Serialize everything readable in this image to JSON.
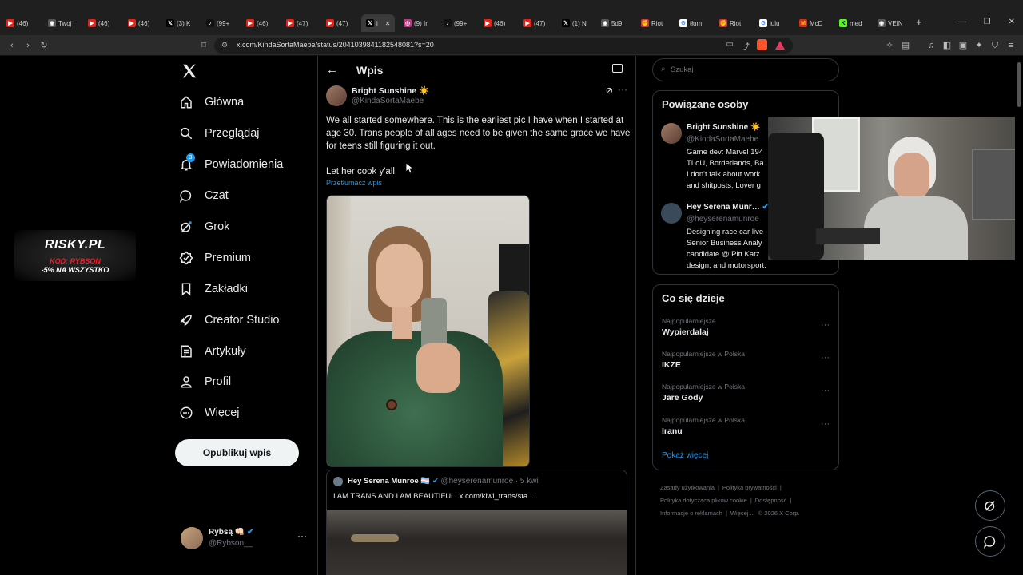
{
  "browser": {
    "tabs": [
      {
        "icon": "yt",
        "label": "(46)"
      },
      {
        "icon": "gen",
        "label": "Twoj"
      },
      {
        "icon": "yt",
        "label": "(46)"
      },
      {
        "icon": "yt",
        "label": "(46)"
      },
      {
        "icon": "x",
        "label": "(3) K"
      },
      {
        "icon": "tk",
        "label": "(99+"
      },
      {
        "icon": "yt",
        "label": "(46)"
      },
      {
        "icon": "yt",
        "label": "(47)"
      },
      {
        "icon": "yt",
        "label": "(47)"
      },
      {
        "icon": "x",
        "label": "i"
      },
      {
        "icon": "ig",
        "label": "(9) Ir"
      },
      {
        "icon": "tk",
        "label": "(99+"
      },
      {
        "icon": "yt",
        "label": "(46)"
      },
      {
        "icon": "yt",
        "label": "(47)"
      },
      {
        "icon": "x",
        "label": "(1) N"
      },
      {
        "icon": "gen",
        "label": "5d9!"
      },
      {
        "icon": "riot",
        "label": "Riot"
      },
      {
        "icon": "gl",
        "label": "tłum"
      },
      {
        "icon": "riot",
        "label": "Riot"
      },
      {
        "icon": "gl",
        "label": "lulu"
      },
      {
        "icon": "mcd",
        "label": "McD"
      },
      {
        "icon": "k",
        "label": "med"
      },
      {
        "icon": "gen",
        "label": "VEIN"
      }
    ],
    "url": "x.com/KindaSortaMaebe/status/2041039841182548081?s=20"
  },
  "nav": {
    "items": [
      {
        "label": "Główna",
        "icon": "home-icon"
      },
      {
        "label": "Przeglądaj",
        "icon": "search-icon"
      },
      {
        "label": "Powiadomienia",
        "icon": "bell-icon",
        "badge": "3"
      },
      {
        "label": "Czat",
        "icon": "chat-icon"
      },
      {
        "label": "Grok",
        "icon": "grok-icon"
      },
      {
        "label": "Premium",
        "icon": "premium-icon"
      },
      {
        "label": "Zakładki",
        "icon": "bookmark-icon"
      },
      {
        "label": "Creator Studio",
        "icon": "rocket-icon"
      },
      {
        "label": "Artykuły",
        "icon": "article-icon"
      },
      {
        "label": "Profil",
        "icon": "person-icon"
      },
      {
        "label": "Więcej",
        "icon": "more-circle-icon"
      }
    ],
    "publish_label": "Opublikuj wpis",
    "user": {
      "name": "Rybsą 👊🏻",
      "handle": "@Rybson__"
    }
  },
  "post": {
    "header_title": "Wpis",
    "author_name": "Bright Sunshine ☀️",
    "author_handle": "@KindaSortaMaebe",
    "text_1": "We all started somewhere. This is the earliest pic I have when I started at age 30. Trans people of all ages need to be given the same grace we have for teens still figuring it out.",
    "text_2": "Let her cook y'all.",
    "translate": "Przetłumacz wpis",
    "quote": {
      "name": "Hey Serena Munroe 🏳️‍⚧️",
      "handle": "@heyserenamunroe",
      "time": "· 5 kwi",
      "text": "I AM TRANS AND I AM BEAUTIFUL.  x.com/kiwi_trans/sta..."
    }
  },
  "right": {
    "search_placeholder": "Szukaj",
    "related_title": "Powiązane osoby",
    "related": [
      {
        "name": "Bright Sunshine ☀️",
        "handle": "@KindaSortaMaebe",
        "bio": "Game dev: Marvel 194 TLoU, Borderlands, Ba I don't talk about work and shitposts; Lover g"
      },
      {
        "name": "Hey Serena Munr…",
        "handle": "@heyserenamunroe",
        "bio": "Designing race car live Senior Business Analy candidate @ Pitt Katz design, and motorsport."
      }
    ],
    "trends_title": "Co się dzieje",
    "trends": [
      {
        "category": "Najpopularniejsze",
        "name": "Wypierdalaj"
      },
      {
        "category": "Najpopularniejsze w Polska",
        "name": "IKZE"
      },
      {
        "category": "Najpopularniejsze w Polska",
        "name": "Jare Gody"
      },
      {
        "category": "Najpopularniejsze w Polska",
        "name": "Iranu"
      }
    ],
    "show_more": "Pokaż więcej",
    "footer": [
      "Zasady użytkowania",
      "|",
      "Polityka prywatności",
      "|",
      "Polityka dotycząca plików cookie",
      "|",
      "Dostępność",
      "|",
      "Informacje o reklamach",
      "|",
      "Więcej ...",
      "© 2026 X Corp."
    ]
  },
  "overlay": {
    "risky_title": "RISKY.PL",
    "risky_code": "KOD: RYBSON",
    "risky_promo": "-5% NA WSZYSTKO"
  },
  "colors": {
    "accent": "#1d9bf0",
    "background": "#000000",
    "border": "#2f3336",
    "risky_red": "#e8202a"
  }
}
